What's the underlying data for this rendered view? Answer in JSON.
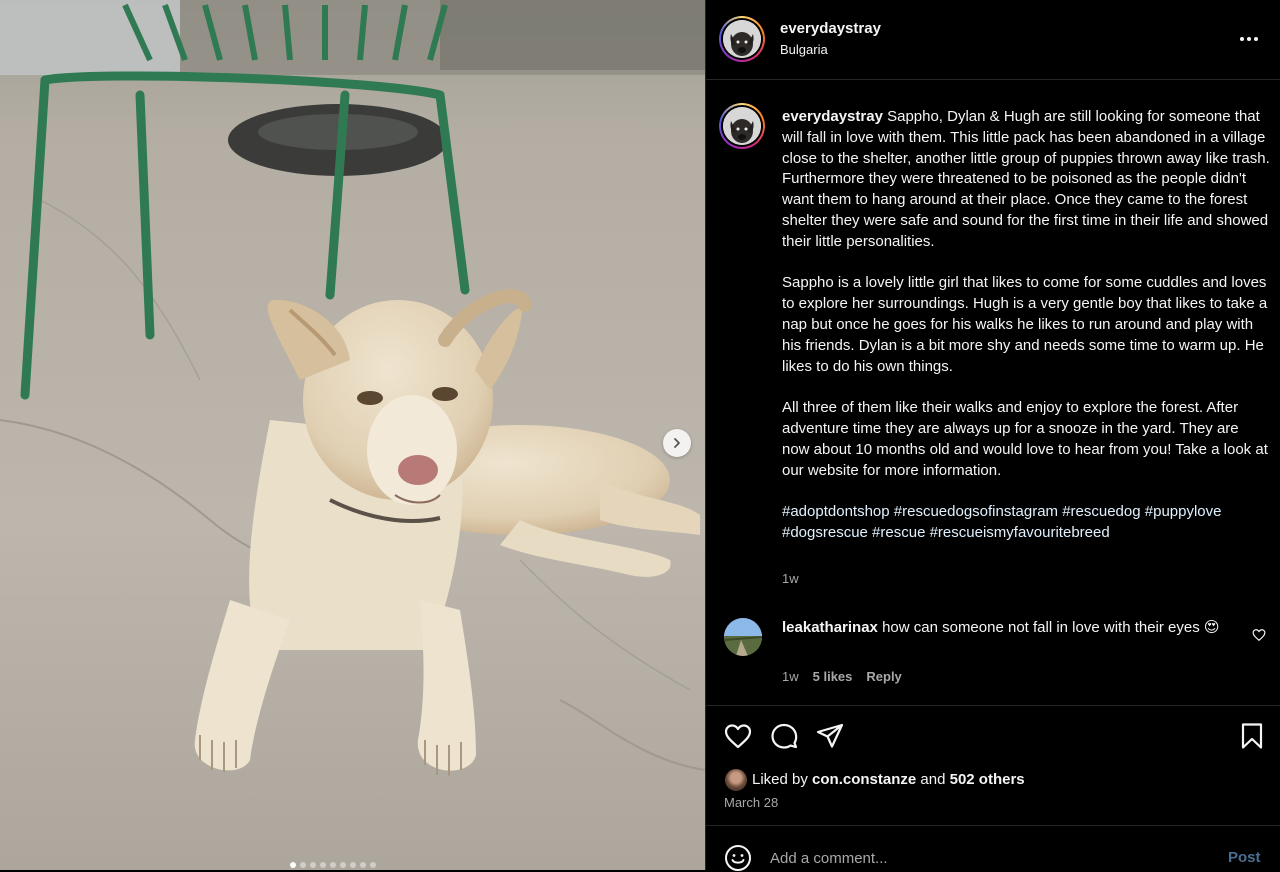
{
  "post": {
    "username": "everydaystray",
    "location": "Bulgaria",
    "caption_paragraphs": [
      "Sappho, Dylan & Hugh are still looking for someone that will fall in love with them. This little pack has been abandoned in a village close to the shelter, another little group of puppies thrown away like trash. Furthermore they were threatened to be poisoned as the people didn't want them to hang around at their place. Once they came to the forest shelter they were safe and sound for the first time in their life and showed their little personalities.",
      "Sappho is a lovely little girl that likes to come for some cuddles and loves to explore her surroundings. Hugh is a very gentle boy that likes to take a nap but once he goes for his walks he likes to run around and play with his friends. Dylan is a bit more shy and needs some time to warm up. He likes to do his own things.",
      "All three of them like their walks and enjoy to explore the forest. After adventure time they are always up for a snooze in the yard. They are now about 10 months old and would love to hear from you! Take a look at our website for more information."
    ],
    "hashtags": "#adoptdontshop #rescuedogsofinstagram #rescuedog #puppylove #dogsrescue #rescue #rescueismyfavouritebreed",
    "time_ago": "1w",
    "liked_by_prefix": "Liked by",
    "liked_by_user": "con.constanze",
    "liked_by_and": "and",
    "liked_by_others": "502 others",
    "date": "March 28",
    "carousel": {
      "count": 9,
      "active_index": 0
    }
  },
  "comments": [
    {
      "username": "leakatharinax",
      "text": "how can someone not fall in love with their eyes 😍",
      "time_ago": "1w",
      "likes": "5 likes",
      "reply_label": "Reply"
    }
  ],
  "add_comment": {
    "placeholder": "Add a comment...",
    "post_label": "Post"
  },
  "icons": {
    "more": "more-horizontal-icon",
    "like": "heart-icon",
    "comment": "comment-icon",
    "share": "share-icon",
    "save": "bookmark-icon",
    "emoji": "emoji-icon",
    "next": "chevron-right-icon"
  },
  "colors": {
    "background": "#000000",
    "text_primary": "#f5f5f5",
    "text_secondary": "#a8a8a8",
    "hashtag": "#e0f1ff",
    "post_button": "#4a6e93",
    "divider": "#262626"
  }
}
